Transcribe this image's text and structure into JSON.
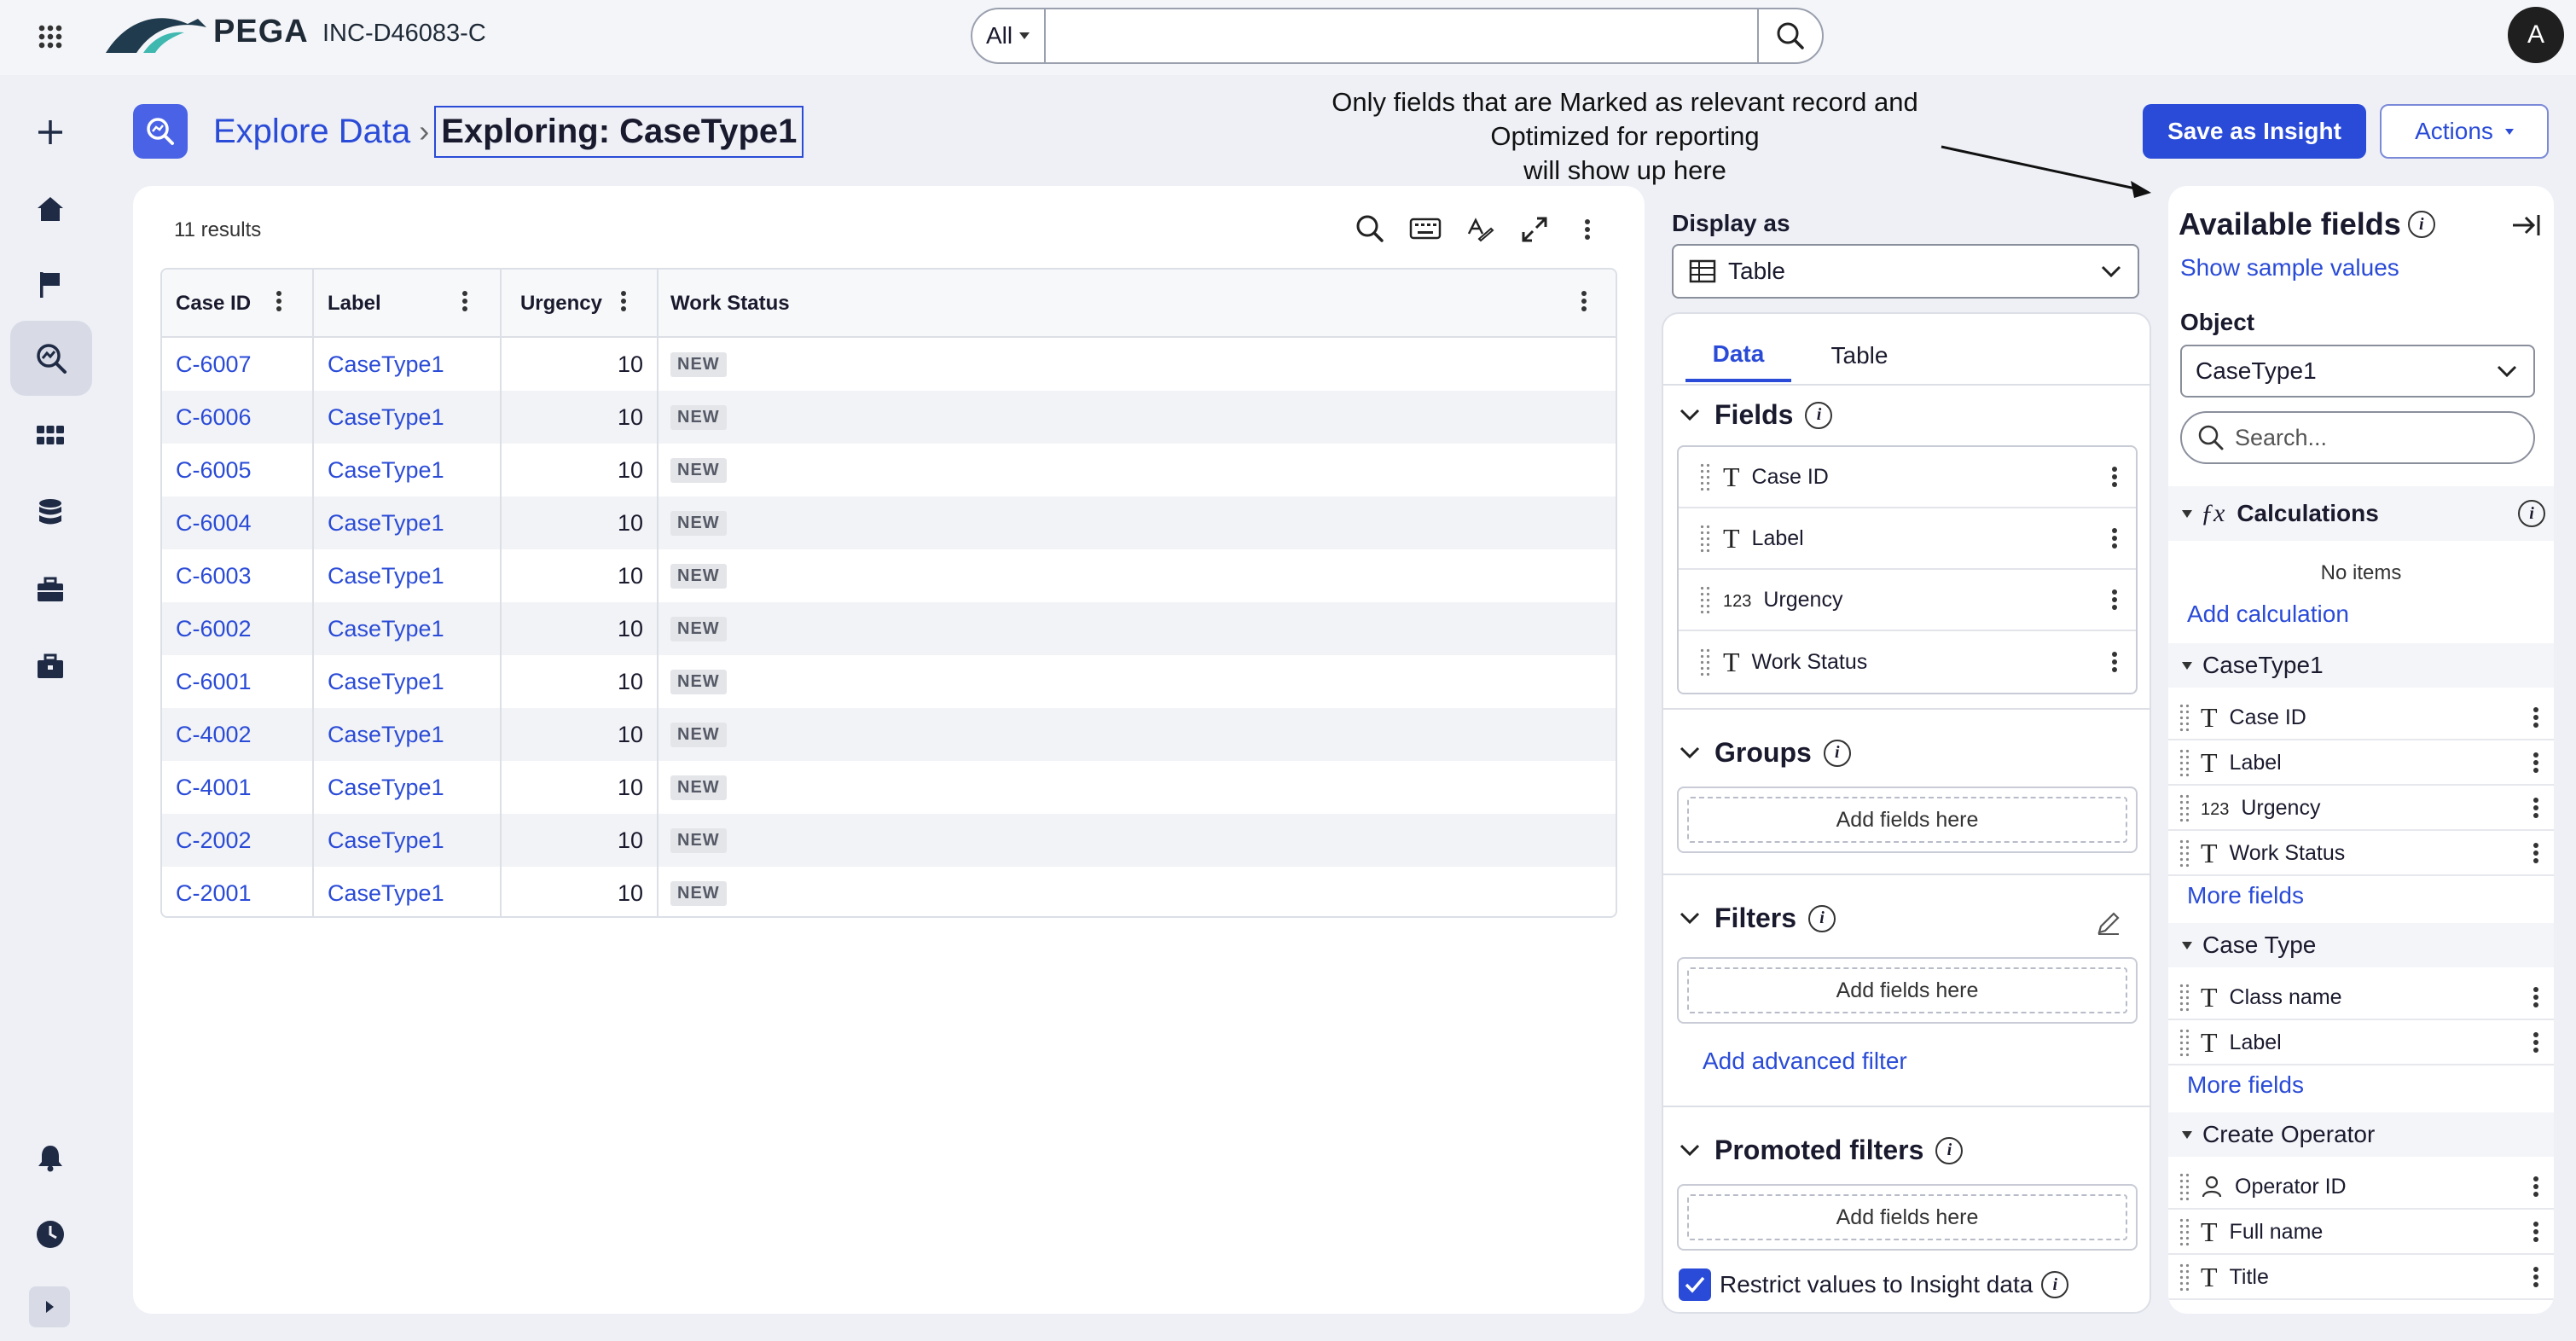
{
  "topbar": {
    "brand": "PEGA",
    "environment": "INC-D46083-C",
    "search_scope": "All",
    "avatar_initial": "A"
  },
  "header": {
    "breadcrumb_root": "Explore Data",
    "breadcrumb_current": "Exploring: CaseType1",
    "annotation": [
      "Only fields that are Marked as relevant record and",
      "Optimized for reporting",
      "will show up here"
    ],
    "save_button": "Save as Insight",
    "actions_button": "Actions"
  },
  "results": {
    "count_label": "11 results",
    "columns": [
      "Case ID",
      "Label",
      "Urgency",
      "Work Status"
    ],
    "rows": [
      {
        "id": "C-6007",
        "label": "CaseType1",
        "urgency": "10",
        "status": "NEW"
      },
      {
        "id": "C-6006",
        "label": "CaseType1",
        "urgency": "10",
        "status": "NEW"
      },
      {
        "id": "C-6005",
        "label": "CaseType1",
        "urgency": "10",
        "status": "NEW"
      },
      {
        "id": "C-6004",
        "label": "CaseType1",
        "urgency": "10",
        "status": "NEW"
      },
      {
        "id": "C-6003",
        "label": "CaseType1",
        "urgency": "10",
        "status": "NEW"
      },
      {
        "id": "C-6002",
        "label": "CaseType1",
        "urgency": "10",
        "status": "NEW"
      },
      {
        "id": "C-6001",
        "label": "CaseType1",
        "urgency": "10",
        "status": "NEW"
      },
      {
        "id": "C-4002",
        "label": "CaseType1",
        "urgency": "10",
        "status": "NEW"
      },
      {
        "id": "C-4001",
        "label": "CaseType1",
        "urgency": "10",
        "status": "NEW"
      },
      {
        "id": "C-2002",
        "label": "CaseType1",
        "urgency": "10",
        "status": "NEW"
      },
      {
        "id": "C-2001",
        "label": "CaseType1",
        "urgency": "10",
        "status": "NEW"
      }
    ]
  },
  "config": {
    "display_as_label": "Display as",
    "display_as_value": "Table",
    "tabs": [
      "Data",
      "Table"
    ],
    "fields_title": "Fields",
    "fields": [
      {
        "icon": "T",
        "name": "Case ID"
      },
      {
        "icon": "T",
        "name": "Label"
      },
      {
        "icon": "123",
        "name": "Urgency"
      },
      {
        "icon": "T",
        "name": "Work Status"
      }
    ],
    "groups_title": "Groups",
    "filters_title": "Filters",
    "promoted_title": "Promoted filters",
    "add_fields_here": "Add fields here",
    "add_advanced_filter": "Add advanced filter",
    "restrict_label": "Restrict values to Insight data"
  },
  "available": {
    "title": "Available fields",
    "show_sample": "Show sample values",
    "object_label": "Object",
    "object_value": "CaseType1",
    "search_placeholder": "Search...",
    "calculations_title": "Calculations",
    "no_items": "No items",
    "add_calculation": "Add calculation",
    "more_fields": "More fields",
    "groups": [
      {
        "name": "CaseType1",
        "fields": [
          {
            "icon": "T",
            "name": "Case ID"
          },
          {
            "icon": "T",
            "name": "Label"
          },
          {
            "icon": "123",
            "name": "Urgency"
          },
          {
            "icon": "T",
            "name": "Work Status"
          }
        ]
      },
      {
        "name": "Case Type",
        "fields": [
          {
            "icon": "T",
            "name": "Class name"
          },
          {
            "icon": "T",
            "name": "Label"
          }
        ]
      },
      {
        "name": "Create Operator",
        "fields": [
          {
            "icon": "person",
            "name": "Operator ID"
          },
          {
            "icon": "T",
            "name": "Full name"
          },
          {
            "icon": "T",
            "name": "Title"
          }
        ]
      }
    ]
  },
  "colors": {
    "accent": "#2a4bd7",
    "background": "#eef0f6"
  }
}
